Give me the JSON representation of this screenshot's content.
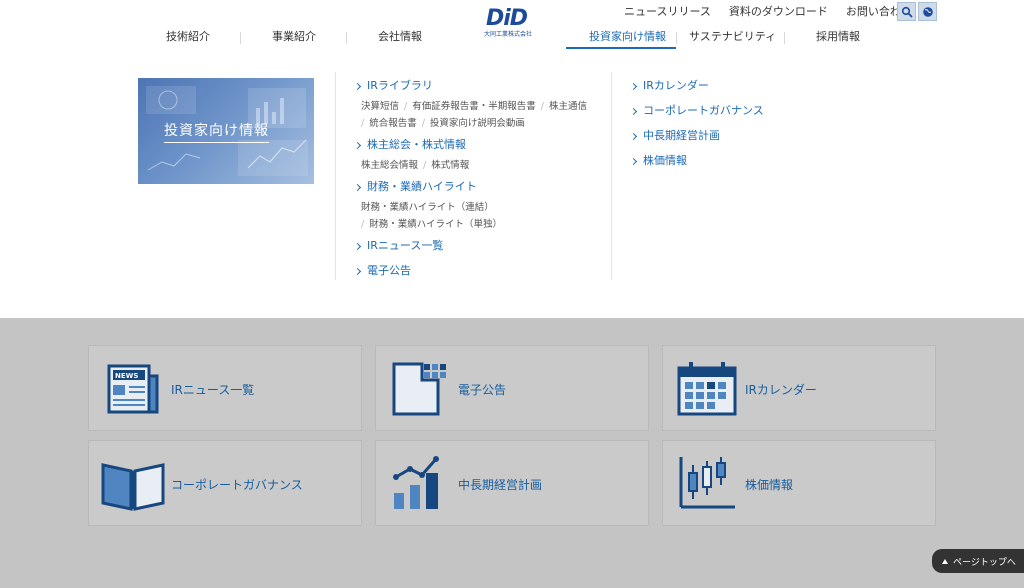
{
  "header": {
    "logo_text": "DiD",
    "logo_subtitle": "大同工業株式会社",
    "util_links": [
      "ニュースリリース",
      "資料のダウンロード",
      "お問い合わせ"
    ],
    "gnav": [
      "技術紹介",
      "事業紹介",
      "会社情報",
      "投資家向け情報",
      "サステナビリティ",
      "採用情報"
    ],
    "active_nav": "投資家向け情報"
  },
  "mega": {
    "hero_title": "投資家向け情報",
    "col1": {
      "ir_library": "IRライブラリ",
      "ir_library_subs": [
        "決算短信",
        "有価証券報告書・半期報告書",
        "株主通信",
        "統合報告書",
        "投資家向け説明会動画"
      ],
      "shareholders": "株主総会・株式情報",
      "shareholders_subs": [
        "株主総会情報",
        "株式情報"
      ],
      "financial": "財務・業績ハイライト",
      "financial_subs": [
        "財務・業績ハイライト（連結）",
        "財務・業績ハイライト（単独）"
      ],
      "ir_news": "IRニュース一覧",
      "public_notice": "電子公告"
    },
    "col2": [
      "IRカレンダー",
      "コーポレートガバナンス",
      "中長期経営計画",
      "株価情報"
    ]
  },
  "cards": [
    "IRニュース一覧",
    "電子公告",
    "IRカレンダー",
    "コーポレートガバナンス",
    "中長期経営計画",
    "株価情報"
  ],
  "pagetop": "ページトップへ",
  "colors": {
    "brand": "#1c4b9b",
    "link": "#1c6ab5",
    "overlay": "#c4c4c4"
  }
}
